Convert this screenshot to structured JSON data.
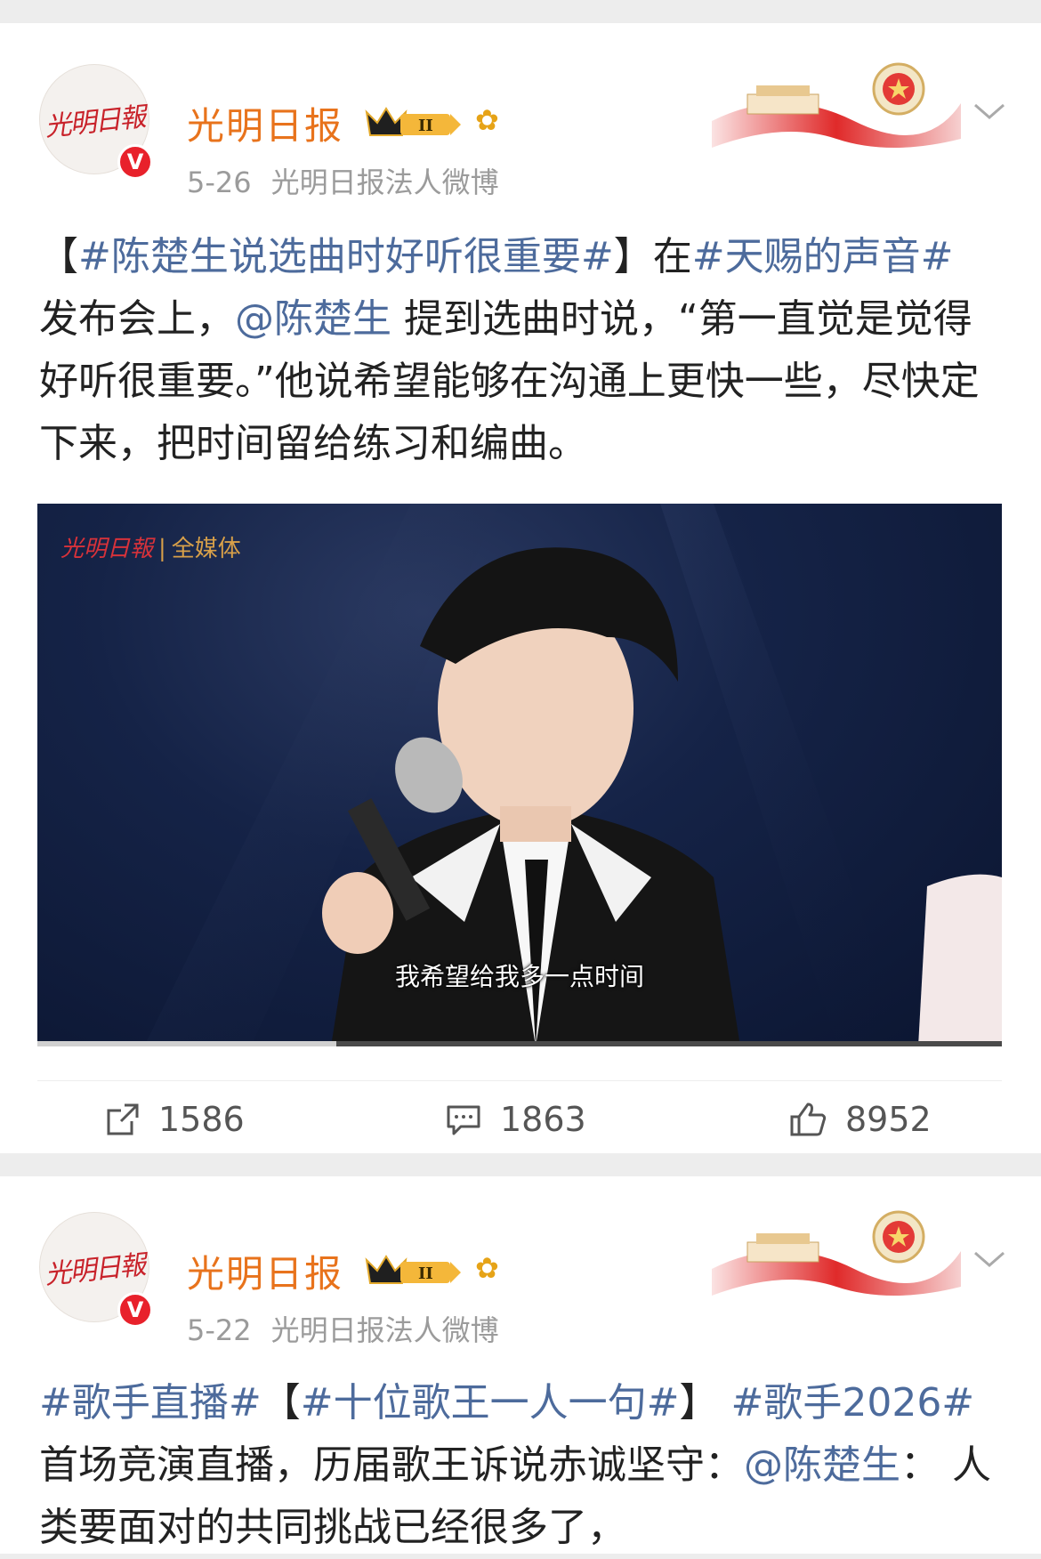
{
  "posts": [
    {
      "author": "光明日报",
      "avatar_text": "光明日報",
      "verified_mark": "V",
      "date": "5-26",
      "source": "光明日报法人微博",
      "content": {
        "tag1": "#陈楚生说选曲时好听很重要#",
        "bracket_open": "【",
        "bracket_close": "】",
        "t1": "在",
        "tag2": "#天赐的声音#",
        "t2": " 发布会上，",
        "mention": "@陈楚生",
        "t3": " 提到选曲时说，“第一直觉是觉得好听很重要。”他说希望能够在沟通上更快一些，尽快定下来，把时间留给练习和编曲。"
      },
      "video": {
        "logo": "光明日報",
        "logo_sep": "|",
        "logo_media": "全媒体",
        "subtitle": "我希望给我多一点时间",
        "progress": 0.31
      },
      "stats": {
        "reposts": "1586",
        "comments": "1863",
        "likes": "8952"
      }
    },
    {
      "author": "光明日报",
      "avatar_text": "光明日報",
      "verified_mark": "V",
      "date": "5-22",
      "source": "光明日报法人微博",
      "content": {
        "tag1": "#歌手直播#",
        "b_open": "【",
        "tag2": "#十位歌王一人一句#",
        "b_close": "】 ",
        "tag3": "#歌手2026#",
        "t1": " 首场竞演直播，历届歌王诉说赤诚坚守：",
        "mention": "@陈楚生",
        "t2": "： 人类要面对的共同挑战已经很多了，"
      }
    }
  ],
  "colors": {
    "name": "#e8731c",
    "tag": "#4d6b9c",
    "vip": "#e8212b"
  }
}
